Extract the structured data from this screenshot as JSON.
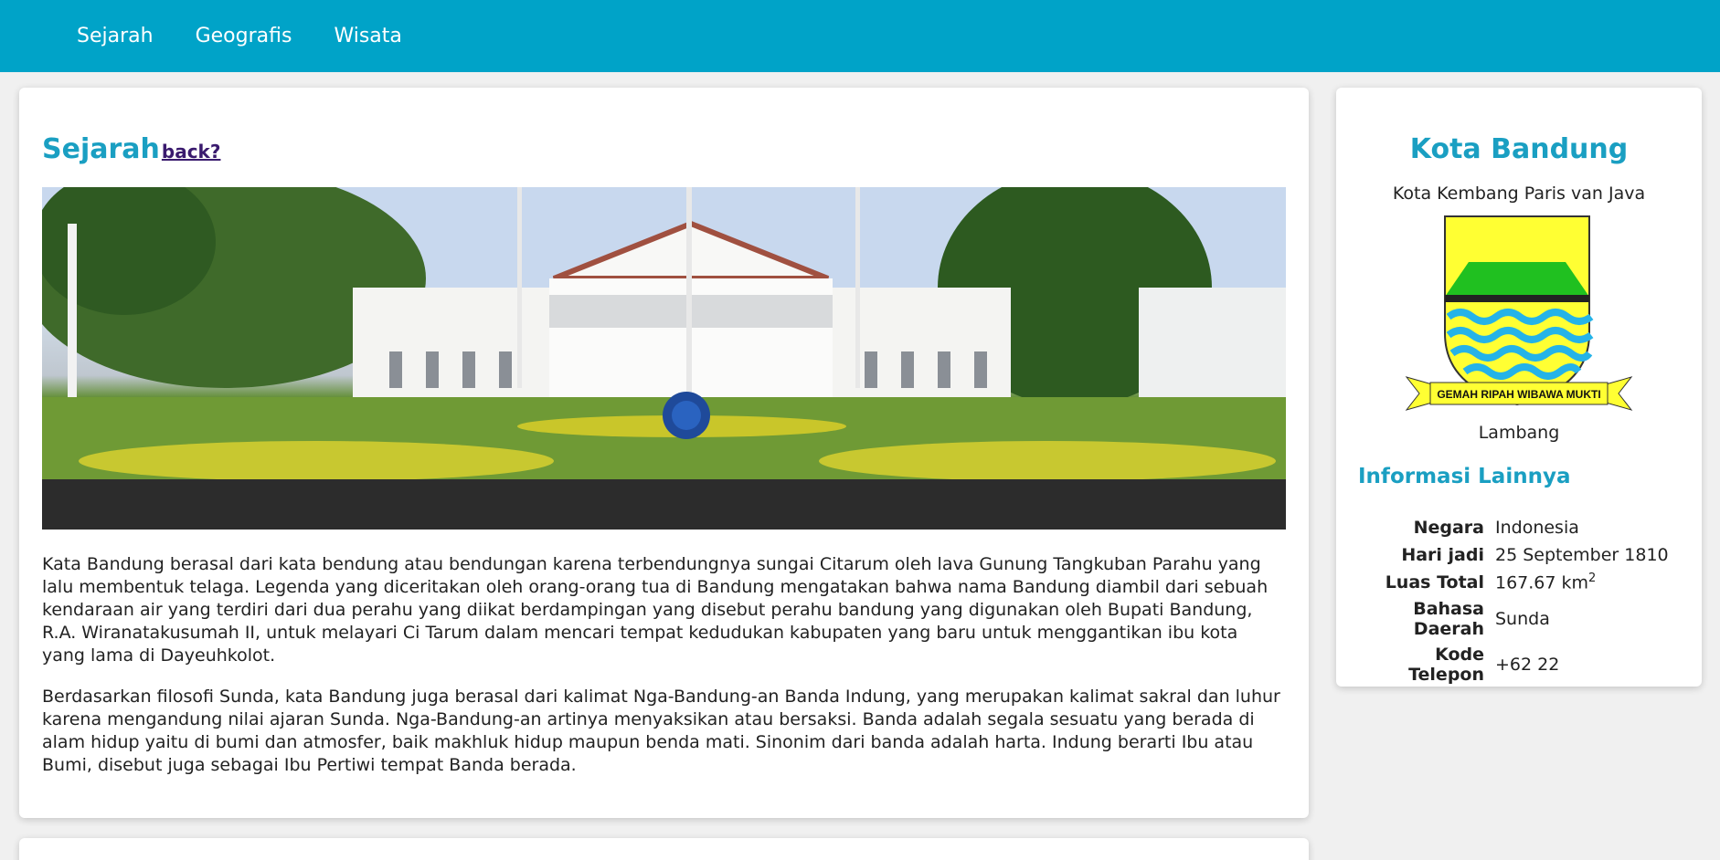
{
  "nav": {
    "items": [
      "Sejarah",
      "Geografis",
      "Wisata"
    ]
  },
  "main": {
    "title": "Sejarah",
    "back_link": "back?",
    "paragraphs": [
      "Kata Bandung berasal dari kata bendung atau bendungan karena terbendungnya sungai Citarum oleh lava Gunung Tangkuban Parahu yang lalu membentuk telaga. Legenda yang diceritakan oleh orang-orang tua di Bandung mengatakan bahwa nama Bandung diambil dari sebuah kendaraan air yang terdiri dari dua perahu yang diikat berdampingan yang disebut perahu bandung yang digunakan oleh Bupati Bandung, R.A. Wiranatakusumah II, untuk melayari Ci Tarum dalam mencari tempat kedudukan kabupaten yang baru untuk menggantikan ibu kota yang lama di Dayeuhkolot.",
      "Berdasarkan filosofi Sunda, kata Bandung juga berasal dari kalimat Nga-Bandung-an Banda Indung, yang merupakan kalimat sakral dan luhur karena mengandung nilai ajaran Sunda. Nga-Bandung-an artinya menyaksikan atau bersaksi. Banda adalah segala sesuatu yang berada di alam hidup yaitu di bumi dan atmosfer, baik makhluk hidup maupun benda mati. Sinonim dari banda adalah harta. Indung berarti Ibu atau Bumi, disebut juga sebagai Ibu Pertiwi tempat Banda berada."
    ]
  },
  "side": {
    "title": "Kota Bandung",
    "subtitle": "Kota Kembang Paris van Java",
    "emblem_motto": "GEMAH RIPAH WIBAWA MUKTI",
    "emblem_caption": "Lambang",
    "info_title": "Informasi Lainnya",
    "info": [
      {
        "key": "Negara",
        "value": "Indonesia"
      },
      {
        "key": "Hari jadi",
        "value": "25 September 1810"
      },
      {
        "key": "Luas Total",
        "value": "167.67 km",
        "sup": "2"
      },
      {
        "key": "Bahasa Daerah",
        "value": "Sunda"
      },
      {
        "key": "Kode Telepon",
        "value": "+62 22"
      }
    ]
  },
  "colors": {
    "nav_bg": "#00a3c8",
    "accent": "#1a9fc2",
    "link_visited": "#3a1a6e"
  }
}
